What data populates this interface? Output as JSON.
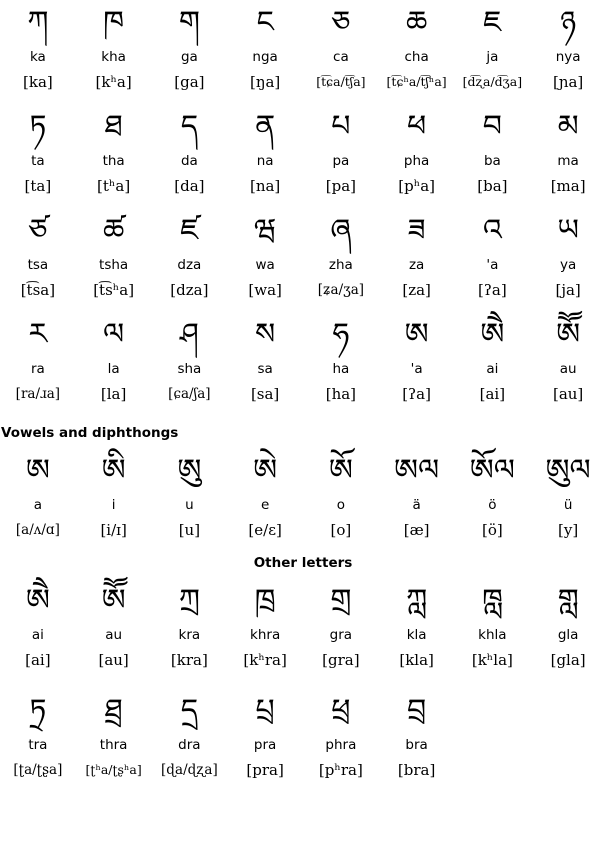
{
  "sections": [
    {
      "id": "consonants",
      "heading": null,
      "rows": [
        {
          "cells": [
            {
              "glyph": "ཀ",
              "translit": "ka",
              "ipa": "[ka]"
            },
            {
              "glyph": "ཁ",
              "translit": "kha",
              "ipa": "[kʰa]"
            },
            {
              "glyph": "ག",
              "translit": "ga",
              "ipa": "[ga]"
            },
            {
              "glyph": "ང",
              "translit": "nga",
              "ipa": "[ŋa]"
            },
            {
              "glyph": "ཅ",
              "translit": "ca",
              "ipa": "[t͡ɕa/t͡ʃa]"
            },
            {
              "glyph": "ཆ",
              "translit": "cha",
              "ipa": "[t͡ɕʰa/t͡ʃʰa]"
            },
            {
              "glyph": "ཇ",
              "translit": "ja",
              "ipa": "[d͡ʐa/d͡ʒa]"
            },
            {
              "glyph": "ཉ",
              "translit": "nya",
              "ipa": "[ɲa]"
            }
          ]
        },
        {
          "cells": [
            {
              "glyph": "ཏ",
              "translit": "ta",
              "ipa": "[ta]"
            },
            {
              "glyph": "ཐ",
              "translit": "tha",
              "ipa": "[tʰa]"
            },
            {
              "glyph": "ད",
              "translit": "da",
              "ipa": "[da]"
            },
            {
              "glyph": "ན",
              "translit": "na",
              "ipa": "[na]"
            },
            {
              "glyph": "པ",
              "translit": "pa",
              "ipa": "[pa]"
            },
            {
              "glyph": "ཕ",
              "translit": "pha",
              "ipa": "[pʰa]"
            },
            {
              "glyph": "བ",
              "translit": "ba",
              "ipa": "[ba]"
            },
            {
              "glyph": "མ",
              "translit": "ma",
              "ipa": "[ma]"
            }
          ]
        },
        {
          "cells": [
            {
              "glyph": "ཙ",
              "translit": "tsa",
              "ipa": "[t͡sa]"
            },
            {
              "glyph": "ཚ",
              "translit": "tsha",
              "ipa": "[t͡sʰa]"
            },
            {
              "glyph": "ཛ",
              "translit": "dza",
              "ipa": "[dza]"
            },
            {
              "glyph": "ཝ",
              "translit": "wa",
              "ipa": "[wa]"
            },
            {
              "glyph": "ཞ",
              "translit": "zha",
              "ipa": "[ʑa/ʒa]"
            },
            {
              "glyph": "ཟ",
              "translit": "za",
              "ipa": "[za]"
            },
            {
              "glyph": "འ",
              "translit": "'a",
              "ipa": "[ʔa]"
            },
            {
              "glyph": "ཡ",
              "translit": "ya",
              "ipa": "[ja]"
            }
          ]
        },
        {
          "cells": [
            {
              "glyph": "ར",
              "translit": "ra",
              "ipa": "[ra/ɹa]"
            },
            {
              "glyph": "ལ",
              "translit": "la",
              "ipa": "[la]"
            },
            {
              "glyph": "ཤ",
              "translit": "sha",
              "ipa": "[ɕa/ʃa]"
            },
            {
              "glyph": "ས",
              "translit": "sa",
              "ipa": "[sa]"
            },
            {
              "glyph": "ཧ",
              "translit": "ha",
              "ipa": "[ha]"
            },
            {
              "glyph": "ཨ",
              "translit": "'a",
              "ipa": "[ʔa]"
            },
            {
              "glyph": "ཨཻ",
              "translit": "ai",
              "ipa": "[ai]"
            },
            {
              "glyph": "ཨཽ",
              "translit": "au",
              "ipa": "[au]"
            }
          ]
        }
      ]
    },
    {
      "id": "vowels",
      "heading": "Vowels and diphthongs",
      "heading_align": "left",
      "rows": [
        {
          "cells": [
            {
              "glyph": "ཨ",
              "translit": "a",
              "ipa": "[a/ʌ/ɑ]"
            },
            {
              "glyph": "ཨི",
              "translit": "i",
              "ipa": "[i/ɪ]"
            },
            {
              "glyph": "ཨུ",
              "translit": "u",
              "ipa": "[u]"
            },
            {
              "glyph": "ཨེ",
              "translit": "e",
              "ipa": "[e/ɛ]"
            },
            {
              "glyph": "ཨོ",
              "translit": "o",
              "ipa": "[o]"
            },
            {
              "glyph": "ཨལ",
              "translit": "ä",
              "ipa": "[æ]"
            },
            {
              "glyph": "ཨོལ",
              "translit": "ö",
              "ipa": "[ö]"
            },
            {
              "glyph": "ཨུལ",
              "translit": "ü",
              "ipa": "[y]"
            }
          ]
        }
      ]
    },
    {
      "id": "other",
      "heading": "Other letters",
      "heading_align": "center",
      "rows": [
        {
          "cells": [
            {
              "glyph": "ཨཻ",
              "translit": "ai",
              "ipa": "[ai]"
            },
            {
              "glyph": "ཨཽ",
              "translit": "au",
              "ipa": "[au]"
            },
            {
              "glyph": "ཀྲ",
              "translit": "kra",
              "ipa": "[kra]"
            },
            {
              "glyph": "ཁྲ",
              "translit": "khra",
              "ipa": "[kʰra]"
            },
            {
              "glyph": "གྲ",
              "translit": "gra",
              "ipa": "[gra]"
            },
            {
              "glyph": "ཀླ",
              "translit": "kla",
              "ipa": "[kla]"
            },
            {
              "glyph": "ཁླ",
              "translit": "khla",
              "ipa": "[kʰla]"
            },
            {
              "glyph": "གླ",
              "translit": "gla",
              "ipa": "[gla]"
            }
          ]
        },
        {
          "cells": [
            {
              "glyph": "ཏྲ",
              "translit": "tra",
              "ipa": "[ʈa/ʈʂa]"
            },
            {
              "glyph": "ཐྲ",
              "translit": "thra",
              "ipa": "[ʈʰa/ʈʂʰa]"
            },
            {
              "glyph": "དྲ",
              "translit": "dra",
              "ipa": "[ɖa/ɖʐa]"
            },
            {
              "glyph": "པྲ",
              "translit": "pra",
              "ipa": "[pra]"
            },
            {
              "glyph": "ཕྲ",
              "translit": "phra",
              "ipa": "[pʰra]"
            },
            {
              "glyph": "བྲ",
              "translit": "bra",
              "ipa": "[bra]"
            },
            {
              "glyph": "",
              "translit": "",
              "ipa": ""
            },
            {
              "glyph": "",
              "translit": "",
              "ipa": ""
            }
          ]
        }
      ]
    }
  ]
}
